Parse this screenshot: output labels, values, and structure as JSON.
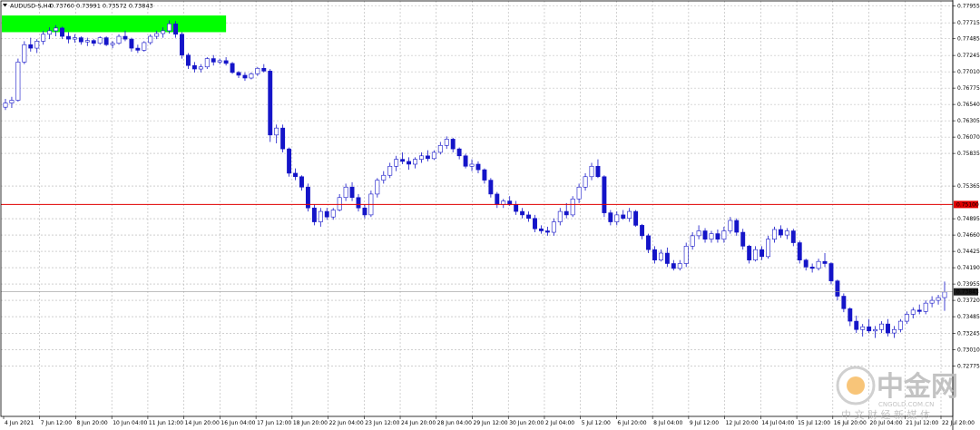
{
  "header": {
    "symbol": "AUDUSD-S,H4",
    "ohlc": "0.73760 0.73991 0.73572 0.73843"
  },
  "colors": {
    "bull": "#ffffff",
    "bear": "#1414c8",
    "wick": "#1414c8",
    "hline": "#e00000",
    "grid": "#b4b4b4",
    "highlight": "#00ff00",
    "price_tag": "#1a1a1a"
  },
  "watermark": {
    "logo_text": "中金网",
    "site": "CNGOLD.COM.CN",
    "tagline": "中 文 财 经 新 媒 体"
  },
  "chart_data": {
    "type": "candlestick",
    "timeframe": "H4",
    "ylim": [
      0.7205,
      0.7803
    ],
    "y_ticks": [
      "0.77955",
      "0.77715",
      "0.77485",
      "0.77245",
      "0.77010",
      "0.76775",
      "0.76540",
      "0.76305",
      "0.76070",
      "0.75835",
      "0.75365",
      "0.74895",
      "0.74660",
      "0.74425",
      "0.74190",
      "0.73955",
      "0.73720",
      "0.73485",
      "0.73245",
      "0.73010",
      "0.72775"
    ],
    "x_ticks": [
      "4 Jun 2021",
      "7 Jun 12:00",
      "8 Jun 20:00",
      "10 Jun 04:00",
      "11 Jun 12:00",
      "14 Jun 20:00",
      "16 Jun 04:00",
      "17 Jun 12:00",
      "18 Jun 20:00",
      "22 Jun 04:00",
      "23 Jun 12:00",
      "24 Jun 20:00",
      "28 Jun 04:00",
      "29 Jun 12:00",
      "30 Jun 20:00",
      "2 Jul 04:00",
      "5 Jul 12:00",
      "6 Jul 20:00",
      "8 Jul 04:00",
      "9 Jul 12:00",
      "12 Jul 20:00",
      "14 Jul 04:00",
      "15 Jul 12:00",
      "16 Jul 20:00",
      "20 Jul 04:00",
      "21 Jul 12:00",
      "22 Jul 20:00"
    ],
    "horizontal_line": {
      "value": 0.751,
      "label": "0.75100"
    },
    "last_price": {
      "value": 0.73843,
      "label": "0.73843"
    },
    "highlight_zone": {
      "x_start": 0,
      "x_end": 35,
      "y_top": 0.7782,
      "y_bottom": 0.7758
    },
    "candles": [
      [
        0.765,
        0.7662,
        0.7646,
        0.7656
      ],
      [
        0.7656,
        0.7665,
        0.7649,
        0.766
      ],
      [
        0.766,
        0.772,
        0.7658,
        0.7715
      ],
      [
        0.7715,
        0.7745,
        0.7712,
        0.774
      ],
      [
        0.774,
        0.775,
        0.773,
        0.7735
      ],
      [
        0.7735,
        0.7748,
        0.7728,
        0.7745
      ],
      [
        0.7745,
        0.776,
        0.774,
        0.7755
      ],
      [
        0.7755,
        0.7765,
        0.7748,
        0.776
      ],
      [
        0.776,
        0.7768,
        0.7752,
        0.7764
      ],
      [
        0.7764,
        0.7766,
        0.7748,
        0.7752
      ],
      [
        0.7752,
        0.7758,
        0.7742,
        0.7748
      ],
      [
        0.7748,
        0.7755,
        0.7743,
        0.775
      ],
      [
        0.775,
        0.7752,
        0.774,
        0.7744
      ],
      [
        0.7744,
        0.775,
        0.7738,
        0.7746
      ],
      [
        0.7746,
        0.7748,
        0.7738,
        0.7742
      ],
      [
        0.7742,
        0.7752,
        0.774,
        0.775
      ],
      [
        0.775,
        0.7752,
        0.7738,
        0.774
      ],
      [
        0.774,
        0.7745,
        0.7735,
        0.7742
      ],
      [
        0.7742,
        0.7755,
        0.774,
        0.7752
      ],
      [
        0.7752,
        0.776,
        0.7745,
        0.7748
      ],
      [
        0.7748,
        0.775,
        0.773,
        0.7735
      ],
      [
        0.7735,
        0.774,
        0.7728,
        0.7732
      ],
      [
        0.7732,
        0.7745,
        0.773,
        0.7743
      ],
      [
        0.7743,
        0.7755,
        0.774,
        0.7752
      ],
      [
        0.7752,
        0.776,
        0.7748,
        0.7756
      ],
      [
        0.7756,
        0.7765,
        0.775,
        0.776
      ],
      [
        0.776,
        0.7775,
        0.7756,
        0.777
      ],
      [
        0.777,
        0.7774,
        0.775,
        0.7755
      ],
      [
        0.7755,
        0.7758,
        0.772,
        0.7725
      ],
      [
        0.7725,
        0.7728,
        0.7705,
        0.771
      ],
      [
        0.771,
        0.7715,
        0.77,
        0.7705
      ],
      [
        0.7705,
        0.7712,
        0.77,
        0.7708
      ],
      [
        0.7708,
        0.7722,
        0.7705,
        0.772
      ],
      [
        0.772,
        0.7725,
        0.771,
        0.7715
      ],
      [
        0.7715,
        0.772,
        0.7712,
        0.7717
      ],
      [
        0.7717,
        0.7722,
        0.771,
        0.7713
      ],
      [
        0.7713,
        0.7715,
        0.7698,
        0.77
      ],
      [
        0.77,
        0.7702,
        0.7692,
        0.7696
      ],
      [
        0.7696,
        0.77,
        0.7688,
        0.7692
      ],
      [
        0.7692,
        0.77,
        0.769,
        0.7698
      ],
      [
        0.7698,
        0.7708,
        0.7695,
        0.7706
      ],
      [
        0.7706,
        0.7712,
        0.77,
        0.7702
      ],
      [
        0.7702,
        0.7705,
        0.76,
        0.761
      ],
      [
        0.761,
        0.7625,
        0.7598,
        0.762
      ],
      [
        0.762,
        0.7625,
        0.7585,
        0.759
      ],
      [
        0.759,
        0.7592,
        0.755,
        0.7555
      ],
      [
        0.7555,
        0.7562,
        0.7545,
        0.755
      ],
      [
        0.755,
        0.7552,
        0.753,
        0.7535
      ],
      [
        0.7535,
        0.754,
        0.75,
        0.7505
      ],
      [
        0.7505,
        0.751,
        0.748,
        0.7485
      ],
      [
        0.7485,
        0.7505,
        0.7478,
        0.75
      ],
      [
        0.75,
        0.7505,
        0.7488,
        0.7492
      ],
      [
        0.7492,
        0.7505,
        0.7488,
        0.7502
      ],
      [
        0.7502,
        0.7525,
        0.75,
        0.752
      ],
      [
        0.752,
        0.754,
        0.7515,
        0.7535
      ],
      [
        0.7535,
        0.7542,
        0.7515,
        0.752
      ],
      [
        0.752,
        0.7525,
        0.75,
        0.7505
      ],
      [
        0.7505,
        0.751,
        0.749,
        0.7495
      ],
      [
        0.7495,
        0.753,
        0.7492,
        0.7525
      ],
      [
        0.7525,
        0.7548,
        0.752,
        0.7545
      ],
      [
        0.7545,
        0.7558,
        0.754,
        0.7552
      ],
      [
        0.7552,
        0.757,
        0.7548,
        0.7565
      ],
      [
        0.7565,
        0.758,
        0.7558,
        0.7575
      ],
      [
        0.7575,
        0.7585,
        0.7568,
        0.7572
      ],
      [
        0.7572,
        0.7578,
        0.756,
        0.7568
      ],
      [
        0.7568,
        0.7578,
        0.7562,
        0.7575
      ],
      [
        0.7575,
        0.7585,
        0.757,
        0.758
      ],
      [
        0.758,
        0.7588,
        0.7572,
        0.7576
      ],
      [
        0.7576,
        0.7588,
        0.7574,
        0.7585
      ],
      [
        0.7585,
        0.76,
        0.7582,
        0.7595
      ],
      [
        0.7595,
        0.7608,
        0.759,
        0.7604
      ],
      [
        0.7604,
        0.7606,
        0.7585,
        0.759
      ],
      [
        0.759,
        0.7592,
        0.7575,
        0.758
      ],
      [
        0.758,
        0.7583,
        0.7562,
        0.7565
      ],
      [
        0.7565,
        0.7575,
        0.7558,
        0.7568
      ],
      [
        0.7568,
        0.7572,
        0.7555,
        0.756
      ],
      [
        0.756,
        0.7562,
        0.754,
        0.7545
      ],
      [
        0.7545,
        0.7548,
        0.752,
        0.7525
      ],
      [
        0.7525,
        0.7528,
        0.7505,
        0.751
      ],
      [
        0.751,
        0.7518,
        0.7505,
        0.7515
      ],
      [
        0.7515,
        0.7522,
        0.7508,
        0.751
      ],
      [
        0.751,
        0.7515,
        0.7495,
        0.75
      ],
      [
        0.75,
        0.7505,
        0.749,
        0.7495
      ],
      [
        0.7495,
        0.75,
        0.7485,
        0.749
      ],
      [
        0.749,
        0.7495,
        0.747,
        0.7475
      ],
      [
        0.7475,
        0.748,
        0.7468,
        0.7472
      ],
      [
        0.7472,
        0.7478,
        0.7465,
        0.747
      ],
      [
        0.747,
        0.749,
        0.7465,
        0.7485
      ],
      [
        0.7485,
        0.7505,
        0.748,
        0.75
      ],
      [
        0.75,
        0.7512,
        0.749,
        0.7495
      ],
      [
        0.7495,
        0.7522,
        0.7492,
        0.7518
      ],
      [
        0.7518,
        0.754,
        0.7512,
        0.7535
      ],
      [
        0.7535,
        0.7555,
        0.753,
        0.755
      ],
      [
        0.755,
        0.757,
        0.7545,
        0.7565
      ],
      [
        0.7565,
        0.7575,
        0.7548,
        0.755
      ],
      [
        0.755,
        0.7552,
        0.7492,
        0.7498
      ],
      [
        0.7498,
        0.7502,
        0.748,
        0.7485
      ],
      [
        0.7485,
        0.75,
        0.748,
        0.7495
      ],
      [
        0.7495,
        0.7502,
        0.7488,
        0.749
      ],
      [
        0.749,
        0.7505,
        0.7485,
        0.75
      ],
      [
        0.75,
        0.7502,
        0.7478,
        0.748
      ],
      [
        0.748,
        0.7482,
        0.746,
        0.7465
      ],
      [
        0.7465,
        0.7468,
        0.744,
        0.7445
      ],
      [
        0.7445,
        0.745,
        0.7425,
        0.743
      ],
      [
        0.743,
        0.7445,
        0.7428,
        0.744
      ],
      [
        0.744,
        0.7448,
        0.742,
        0.7425
      ],
      [
        0.7425,
        0.743,
        0.7415,
        0.7418
      ],
      [
        0.7418,
        0.743,
        0.7415,
        0.7425
      ],
      [
        0.7425,
        0.7455,
        0.742,
        0.745
      ],
      [
        0.745,
        0.747,
        0.7445,
        0.7465
      ],
      [
        0.7465,
        0.748,
        0.746,
        0.7472
      ],
      [
        0.7472,
        0.7476,
        0.7455,
        0.746
      ],
      [
        0.746,
        0.7472,
        0.7455,
        0.7468
      ],
      [
        0.7468,
        0.7474,
        0.7455,
        0.746
      ],
      [
        0.746,
        0.7478,
        0.7455,
        0.7472
      ],
      [
        0.7472,
        0.7492,
        0.7468,
        0.7487
      ],
      [
        0.7487,
        0.749,
        0.7465,
        0.747
      ],
      [
        0.747,
        0.7475,
        0.7445,
        0.745
      ],
      [
        0.745,
        0.7452,
        0.7425,
        0.743
      ],
      [
        0.743,
        0.745,
        0.7428,
        0.7445
      ],
      [
        0.7445,
        0.745,
        0.743,
        0.7435
      ],
      [
        0.7435,
        0.7465,
        0.7432,
        0.746
      ],
      [
        0.746,
        0.7478,
        0.7455,
        0.7474
      ],
      [
        0.7474,
        0.748,
        0.7462,
        0.7466
      ],
      [
        0.7466,
        0.7476,
        0.746,
        0.7472
      ],
      [
        0.7472,
        0.7475,
        0.745,
        0.7455
      ],
      [
        0.7455,
        0.7458,
        0.7425,
        0.743
      ],
      [
        0.743,
        0.7432,
        0.7415,
        0.742
      ],
      [
        0.742,
        0.7425,
        0.7412,
        0.7418
      ],
      [
        0.7418,
        0.7432,
        0.7415,
        0.7428
      ],
      [
        0.7428,
        0.744,
        0.742,
        0.7425
      ],
      [
        0.7425,
        0.7427,
        0.7395,
        0.74
      ],
      [
        0.74,
        0.7402,
        0.7372,
        0.7378
      ],
      [
        0.7378,
        0.7382,
        0.7355,
        0.736
      ],
      [
        0.736,
        0.7362,
        0.7335,
        0.7342
      ],
      [
        0.7342,
        0.735,
        0.7325,
        0.733
      ],
      [
        0.733,
        0.7338,
        0.732,
        0.7334
      ],
      [
        0.7334,
        0.7345,
        0.7325,
        0.7328
      ],
      [
        0.7328,
        0.7335,
        0.7318,
        0.733
      ],
      [
        0.733,
        0.7342,
        0.7325,
        0.7338
      ],
      [
        0.7338,
        0.7345,
        0.732,
        0.7325
      ],
      [
        0.7325,
        0.7335,
        0.7318,
        0.733
      ],
      [
        0.733,
        0.7345,
        0.7326,
        0.7342
      ],
      [
        0.7342,
        0.7356,
        0.7338,
        0.7352
      ],
      [
        0.7352,
        0.7362,
        0.7346,
        0.7358
      ],
      [
        0.7358,
        0.7366,
        0.7352,
        0.7356
      ],
      [
        0.7356,
        0.7372,
        0.7352,
        0.7368
      ],
      [
        0.7368,
        0.7378,
        0.7362,
        0.7372
      ],
      [
        0.7372,
        0.738,
        0.7366,
        0.7376
      ],
      [
        0.7376,
        0.7399,
        0.7357,
        0.7384
      ]
    ]
  }
}
